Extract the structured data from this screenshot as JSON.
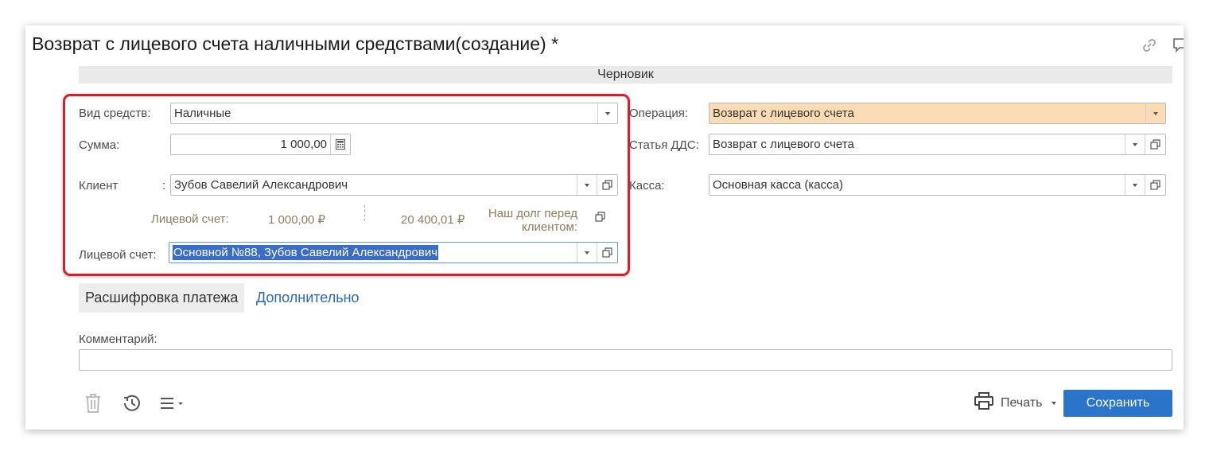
{
  "window": {
    "title": "Возврат с лицевого счета наличными средствами(создание) *",
    "status": "Черновик"
  },
  "left_form": {
    "vid_label": "Вид средств:",
    "vid_value": "Наличные",
    "summa_label": "Сумма:",
    "summa_value": "1 000,00",
    "client_label": "Клиент",
    "client_colon": ":",
    "client_value": "Зубов Савелий Александрович",
    "account_info_label": "Лицевой счет:",
    "account_info_value": "1 000,00 ₽",
    "debt_value": "20 400,01 ₽",
    "debt_label": "Наш долг перед клиентом:",
    "account_label": "Лицевой счет:",
    "account_value": "Основной №88, Зубов Савелий Александрович"
  },
  "right_form": {
    "operation_label": "Операция:",
    "operation_value": "Возврат с лицевого счета",
    "dds_label": "Статья ДДС:",
    "dds_value": "Возврат с лицевого счета",
    "kassa_label": "Касса:",
    "kassa_value": "Основная касса (касса)"
  },
  "tabs": {
    "active": "Расшифровка платежа",
    "other": "Дополнительно"
  },
  "comment": {
    "label": "Комментарий:",
    "value": ""
  },
  "footer": {
    "print_label": "Печать",
    "save_label": "Сохранить"
  },
  "colors": {
    "accent": "#2a74c9",
    "link": "#2d69b9",
    "highlight_field": "#fbdcb4",
    "frame": "#d5202b",
    "info_text": "#8b7d5e"
  },
  "icons": [
    "link-icon",
    "comment-icon",
    "calculator-icon",
    "open-in-window-icon",
    "trash-icon",
    "history-icon",
    "menu-icon",
    "printer-icon"
  ]
}
